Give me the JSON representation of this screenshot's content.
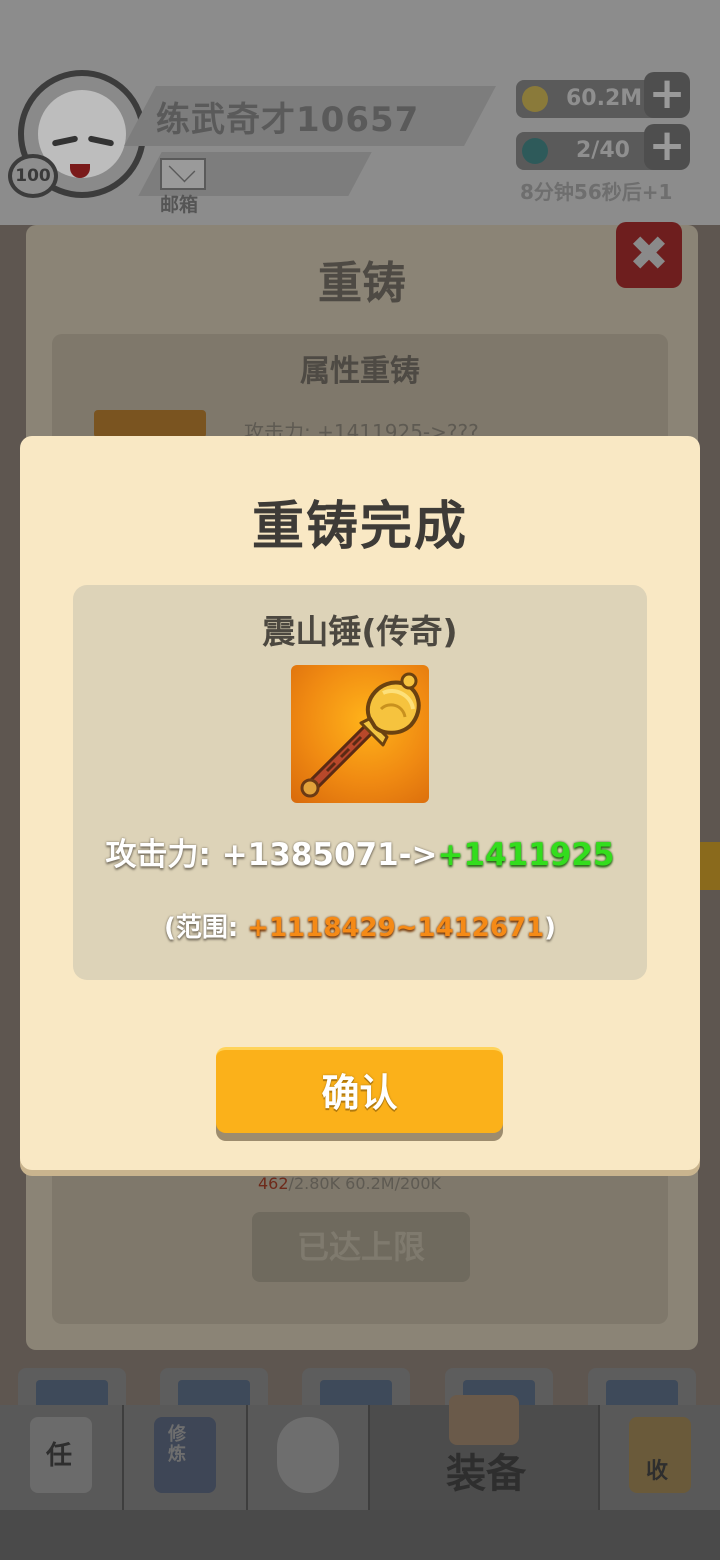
{
  "header": {
    "player_name": "练武奇才10657",
    "level": "100",
    "mail_label": "邮箱",
    "gold": "60.2M",
    "energy": "2/40",
    "energy_timer": "8分钟56秒后+1"
  },
  "reforge_panel": {
    "title": "重铸",
    "section_title": "属性重铸",
    "attack_preview": "攻击力: +1411925->???",
    "cost_current": "462",
    "cost_rest": "/2.80K  60.2M/200K",
    "maxed_button": "已达上限"
  },
  "bottom_nav": {
    "equip_label": "装备",
    "task_glyph": "任",
    "train_glyph": "修炼",
    "collect_glyph": "收"
  },
  "modal": {
    "title": "重铸完成",
    "item_name": "震山锤(传奇)",
    "attack_prefix": "攻击力: +1385071->",
    "attack_new": "+1411925",
    "range_open": "(范围: ",
    "range_value": "+1118429~1412671",
    "range_close": ")",
    "confirm_label": "确认"
  },
  "colors": {
    "modal_bg": "#f9e8c4",
    "card_bg": "#ddd3b8",
    "confirm_bg": "#fbb11a",
    "new_value_green": "#33dd1d",
    "range_orange": "#f58a16"
  },
  "icons": {
    "item": "golden-hammer-icon",
    "close": "close-x-icon",
    "gold": "coin-icon",
    "energy": "gem-icon"
  }
}
